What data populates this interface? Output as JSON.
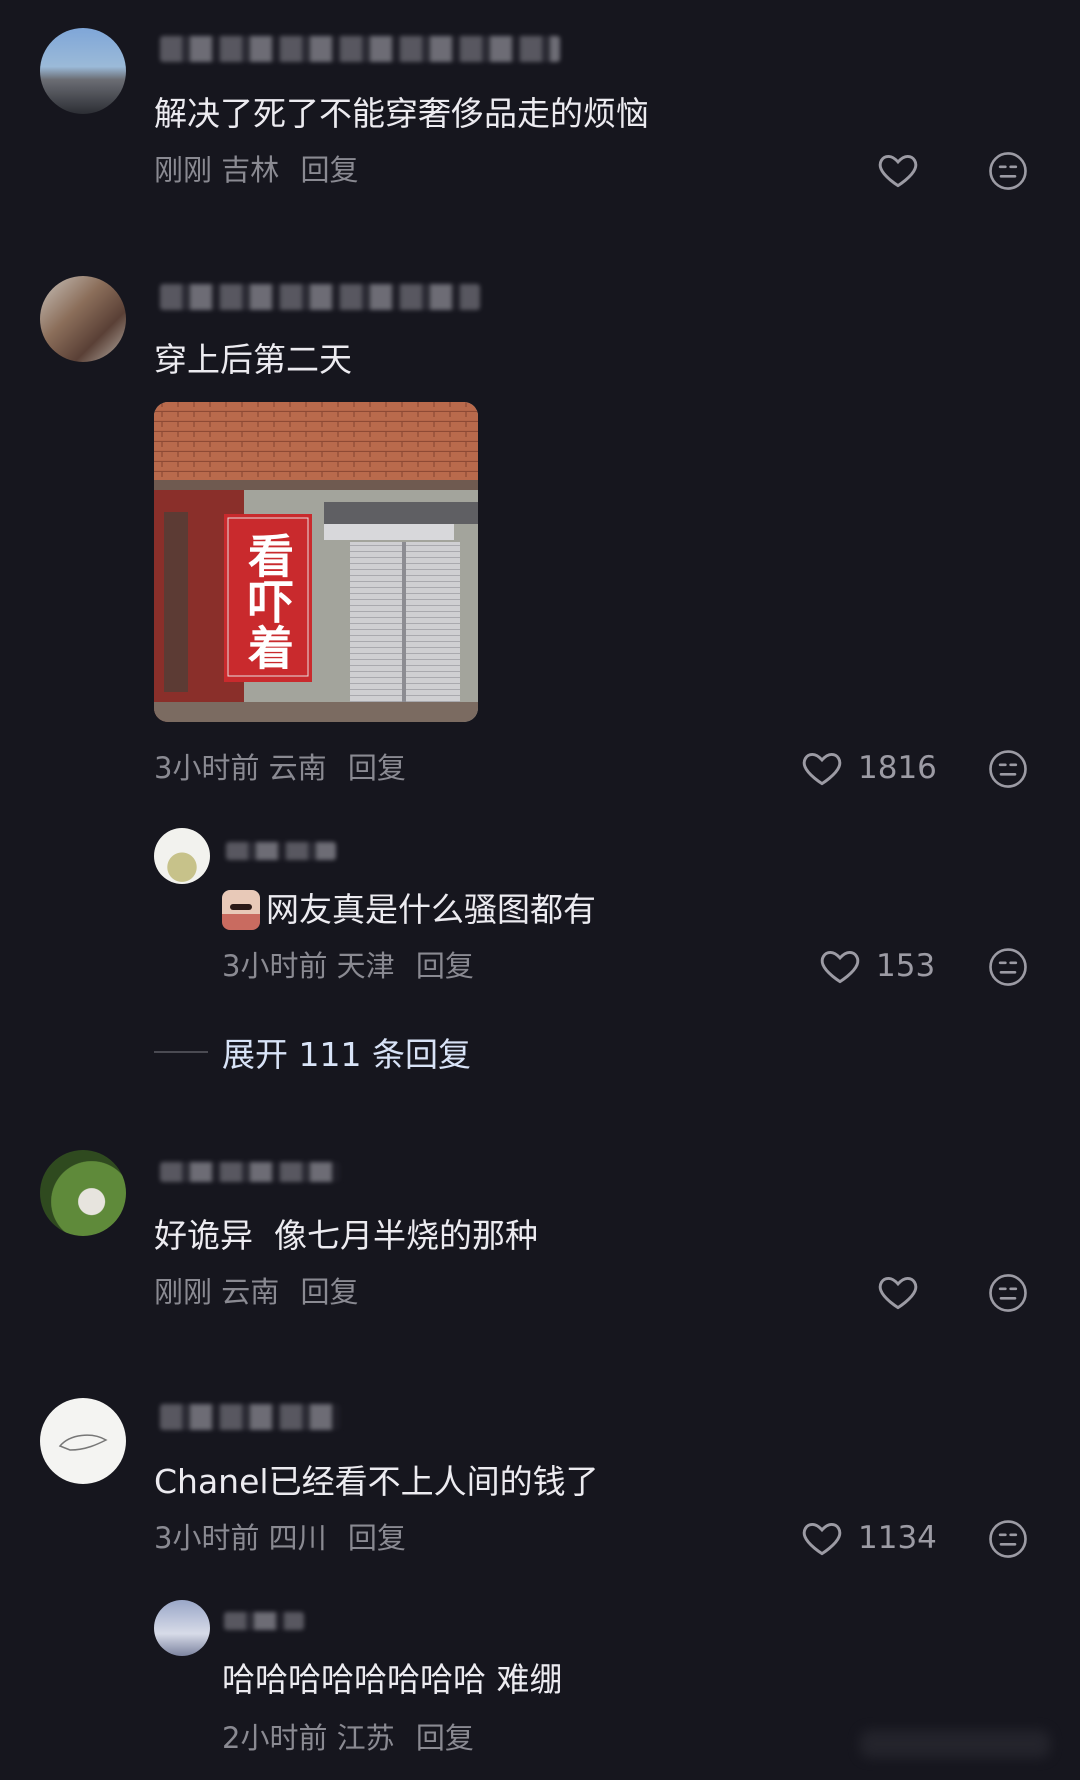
{
  "comments": [
    {
      "text": "解决了死了不能穿奢侈品走的烦恼",
      "time": "刚刚",
      "location": "吉林",
      "reply": "回复",
      "likes": ""
    },
    {
      "text": "穿上后第二天",
      "image_sign_text": "看吓着",
      "time": "3小时前",
      "location": "云南",
      "reply": "回复",
      "likes": "1816",
      "reply_item": {
        "text": "网友真是什么骚图都有",
        "time": "3小时前",
        "location": "天津",
        "reply": "回复",
        "likes": "153"
      },
      "expand_label": "展开 111 条回复"
    },
    {
      "text": "好诡异  像七月半烧的那种",
      "time": "刚刚",
      "location": "云南",
      "reply": "回复",
      "likes": ""
    },
    {
      "text": "Chanel已经看不上人间的钱了",
      "time": "3小时前",
      "location": "四川",
      "reply": "回复",
      "likes": "1134",
      "reply_item": {
        "text": "哈哈哈哈哈哈哈哈 难绷",
        "time": "2小时前",
        "location": "江苏",
        "reply": "回复"
      }
    }
  ],
  "icons": {
    "like": "heart-outline-icon",
    "dislike": "neutral-face-icon",
    "emoji": "sticker-emoji-icon"
  },
  "colors": {
    "background": "#16161e",
    "text": "#ecebf0",
    "meta": "#8a8a92",
    "expand": "#d8e3f7"
  }
}
